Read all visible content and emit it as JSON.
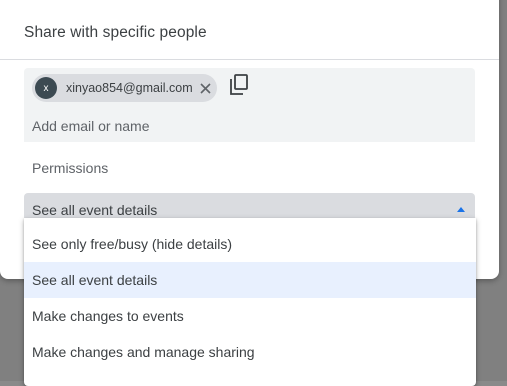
{
  "dialog": {
    "title": "Share with specific people"
  },
  "recipients": {
    "chips": [
      {
        "initial": "x",
        "email": "xinyao854@gmail.com"
      }
    ],
    "input_placeholder": "Add email or name"
  },
  "permissions": {
    "label": "Permissions",
    "selected": "See all event details",
    "options": [
      "See only free/busy (hide details)",
      "See all event details",
      "Make changes to events",
      "Make changes and manage sharing"
    ],
    "highlighted_index": 1
  },
  "colors": {
    "chip_background": "#dadce0",
    "avatar": "#3c4a52",
    "highlight": "#e8f0fe",
    "accent": "#1a73e8"
  },
  "icons": {
    "chip_close": "close-icon",
    "copy": "copy-icon",
    "dropdown_arrow": "arrow-up-icon"
  }
}
